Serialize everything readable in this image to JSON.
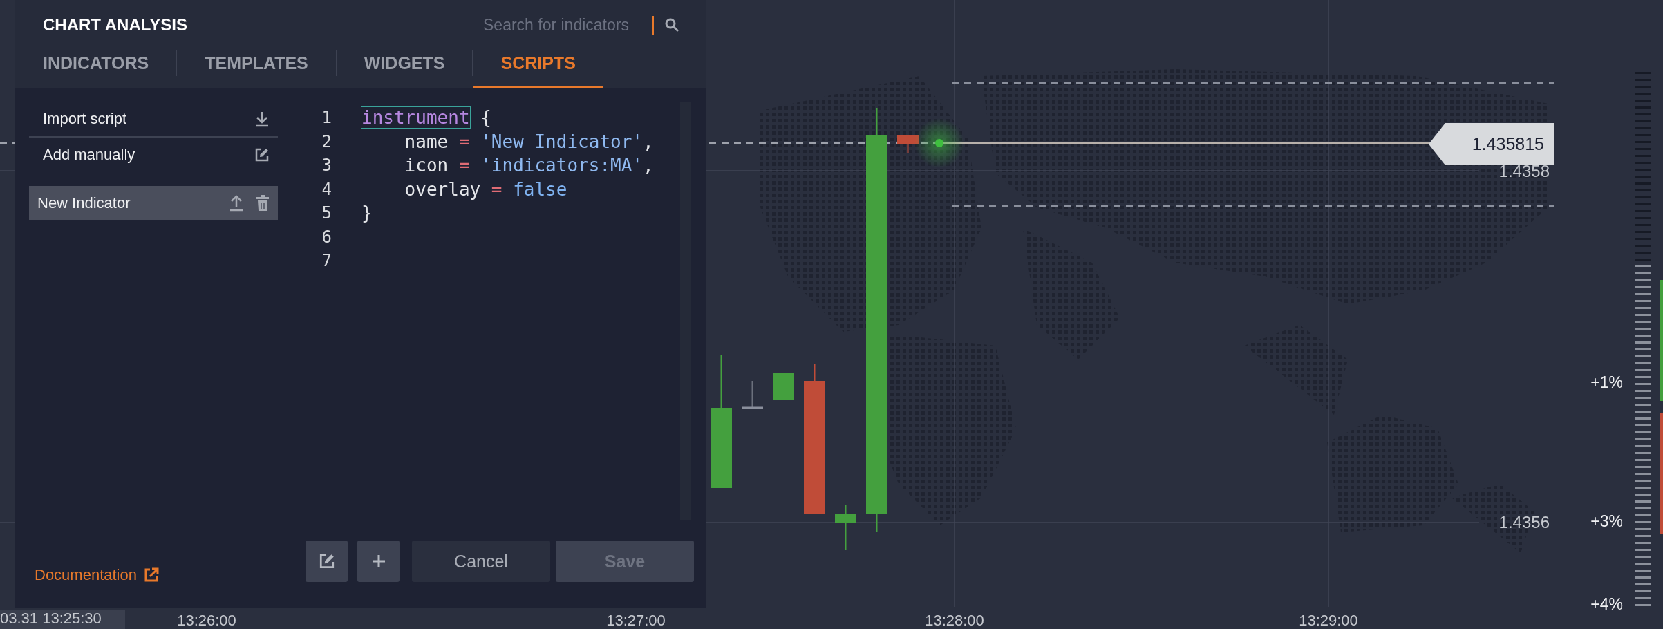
{
  "panel": {
    "title": "CHART ANALYSIS",
    "search": {
      "placeholder": "Search for indicators"
    },
    "tabs": [
      {
        "label": "INDICATORS",
        "selected": false
      },
      {
        "label": "TEMPLATES",
        "selected": false
      },
      {
        "label": "WIDGETS",
        "selected": false
      },
      {
        "label": "SCRIPTS",
        "selected": true
      }
    ],
    "actions": [
      {
        "label": "Import script",
        "kind": "import"
      },
      {
        "label": "Add manually",
        "kind": "add"
      }
    ],
    "scripts": [
      {
        "name": "New Indicator",
        "selected": true
      }
    ],
    "editor": {
      "lines": [
        {
          "number": "1",
          "tokens": [
            {
              "text": "instrument",
              "kind": "match"
            },
            {
              "text": " {",
              "kind": "plain"
            }
          ]
        },
        {
          "number": "2",
          "tokens": [
            {
              "text": "    name ",
              "kind": "plain"
            },
            {
              "text": "=",
              "kind": "operator"
            },
            {
              "text": " 'New Indicator'",
              "kind": "string"
            },
            {
              "text": ",",
              "kind": "plain"
            }
          ]
        },
        {
          "number": "3",
          "tokens": [
            {
              "text": "    icon ",
              "kind": "plain"
            },
            {
              "text": "=",
              "kind": "operator"
            },
            {
              "text": " 'indicators:MA'",
              "kind": "string"
            },
            {
              "text": ",",
              "kind": "plain"
            }
          ]
        },
        {
          "number": "4",
          "tokens": [
            {
              "text": "    overlay ",
              "kind": "plain"
            },
            {
              "text": "=",
              "kind": "operator"
            },
            {
              "text": " false",
              "kind": "literal"
            }
          ]
        },
        {
          "number": "5",
          "tokens": [
            {
              "text": "}",
              "kind": "plain"
            }
          ]
        },
        {
          "number": "6"
        },
        {
          "number": "7"
        }
      ]
    },
    "documentation_link": "Documentation",
    "tool_buttons": [
      {
        "kind": "edit"
      },
      {
        "kind": "add"
      }
    ],
    "buttons": [
      {
        "label": "Cancel",
        "disabled": false
      },
      {
        "label": "Save",
        "disabled": true
      }
    ]
  },
  "chart": {
    "price_tag": "1.435815",
    "price_labels": [
      "1.4358",
      "1.4356"
    ],
    "percent_labels": [
      "+1%",
      "+3%",
      "+4%"
    ],
    "time_labels": [
      "03.31 13:25:30",
      "13:26:00",
      "13:27:00",
      "13:28:00",
      "13:29:00"
    ]
  }
}
